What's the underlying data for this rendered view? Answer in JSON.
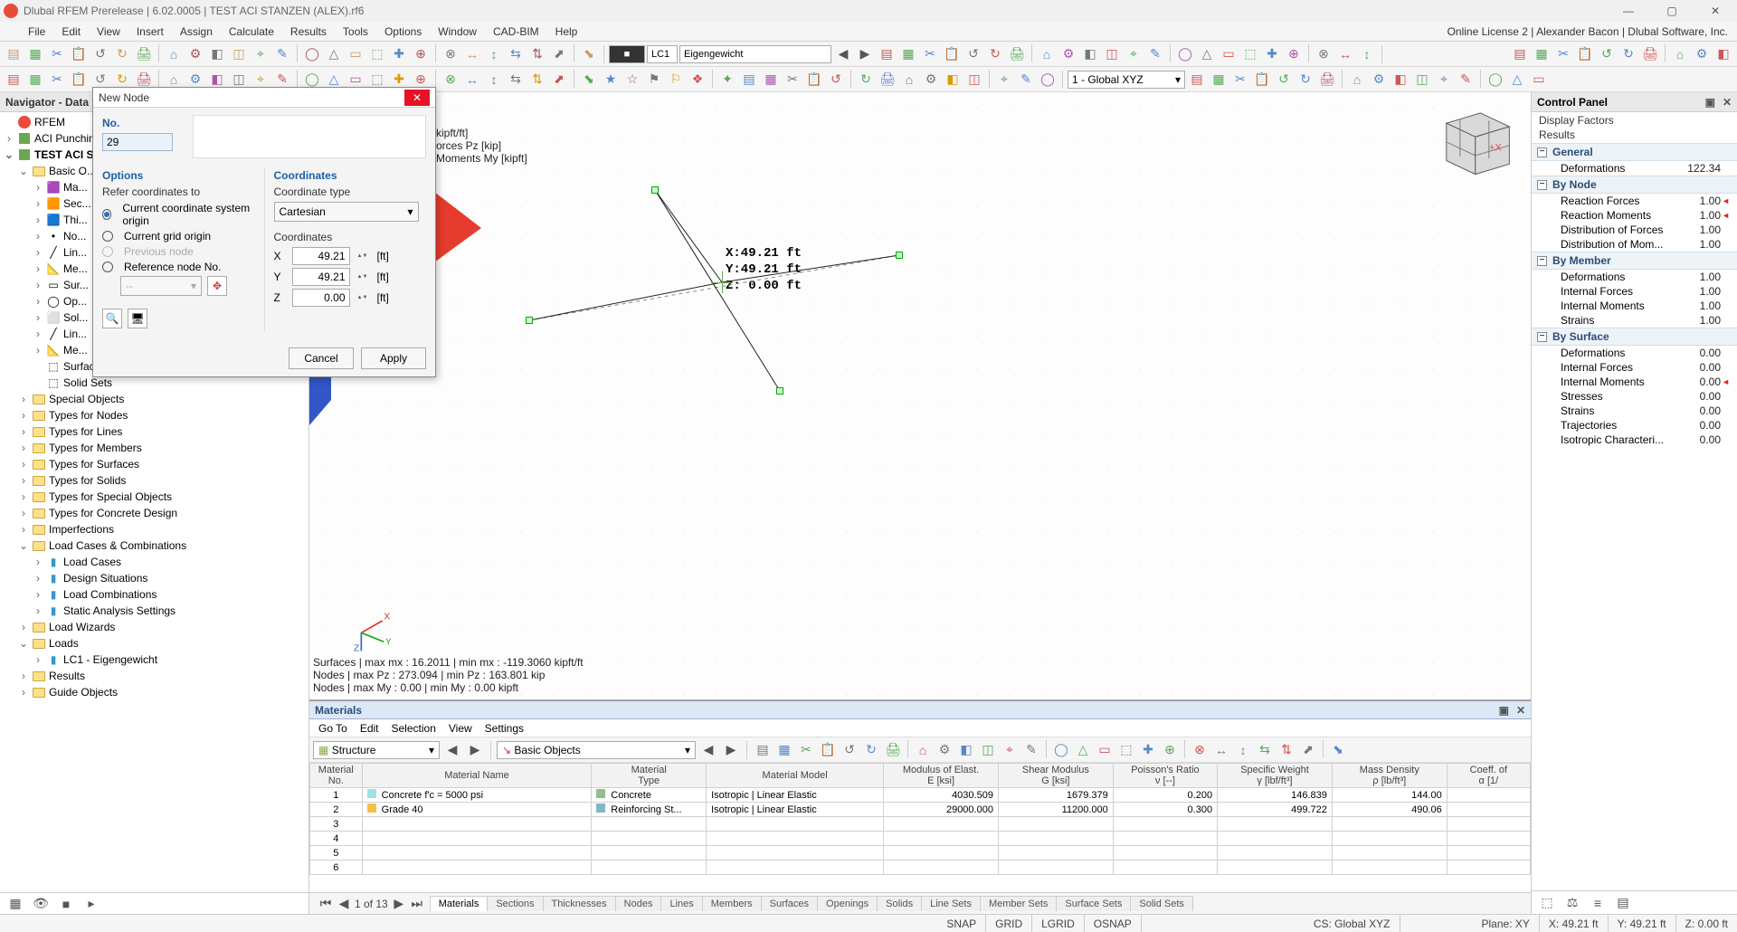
{
  "app_title": "Dlubal RFEM Prerelease | 6.02.0005 | TEST ACI STANZEN (ALEX).rf6",
  "license_text": "Online License 2 | Alexander Bacon | Dlubal Software, Inc.",
  "menus": [
    "File",
    "Edit",
    "View",
    "Insert",
    "Assign",
    "Calculate",
    "Results",
    "Tools",
    "Options",
    "Window",
    "CAD-BIM",
    "Help"
  ],
  "lc_name": "LC1",
  "lc_desc": "Eigengewicht",
  "coord_system": "1 - Global XYZ",
  "navigator": {
    "title": "Navigator - Data",
    "root": "RFEM",
    "top1": "ACI Punchin...",
    "top2": "TEST ACI S...",
    "basic": "Basic O...",
    "bo_items": [
      "Ma...",
      "Sec...",
      "Thi...",
      "No...",
      "Lin...",
      "Me...",
      "Sur...",
      "Op...",
      "Sol...",
      "Lin...",
      "Me..."
    ],
    "bo_tail": [
      "Surface Sets",
      "Solid Sets"
    ],
    "sections": [
      "Special Objects",
      "Types for Nodes",
      "Types for Lines",
      "Types for Members",
      "Types for Surfaces",
      "Types for Solids",
      "Types for Special Objects",
      "Types for Concrete Design",
      "Imperfections"
    ],
    "lcc": "Load Cases & Combinations",
    "lcc_items": [
      "Load Cases",
      "Design Situations",
      "Load Combinations",
      "Static Analysis Settings"
    ],
    "bottom": [
      "Load Wizards",
      "Loads"
    ],
    "lc_child": "LC1 - Eigengewicht",
    "tail": [
      "Results",
      "Guide Objects"
    ]
  },
  "viewport": {
    "labels_top": [
      "kipft/ft]",
      "orces Pz [kip]",
      "Moments My [kipft]"
    ],
    "pos_x": "X:49.21 ft",
    "pos_y": "Y:49.21 ft",
    "pos_z": "Z: 0.00 ft",
    "info1": "Surfaces | max mx : 16.2011 | min mx : -119.3060 kipft/ft",
    "info2": "Nodes | max Pz : 273.094 | min Pz : 163.801 kip",
    "info3": "Nodes | max My : 0.00 | min My : 0.00 kipft"
  },
  "materials": {
    "title": "Materials",
    "menus": [
      "Go To",
      "Edit",
      "Selection",
      "View",
      "Settings"
    ],
    "combo1": "Structure",
    "combo2": "Basic Objects",
    "cols": [
      "Material\nNo.",
      "Material Name",
      "Material\nType",
      "Material Model",
      "Modulus of Elast.\nE [ksi]",
      "Shear Modulus\nG [ksi]",
      "Poisson's Ratio\nν [--]",
      "Specific Weight\nγ [lbf/ft³]",
      "Mass Density\nρ [lb/ft³]",
      "Coeff. of\nα [1/"
    ],
    "rows": [
      {
        "no": "1",
        "name": "Concrete f'c = 5000 psi",
        "type": "Concrete",
        "model": "Isotropic | Linear Elastic",
        "E": "4030.509",
        "G": "1679.379",
        "nu": "0.200",
        "gamma": "146.839",
        "rho": "144.00",
        "alpha": ""
      },
      {
        "no": "2",
        "name": "Grade 40",
        "type": "Reinforcing St...",
        "model": "Isotropic | Linear Elastic",
        "E": "29000.000",
        "G": "11200.000",
        "nu": "0.300",
        "gamma": "499.722",
        "rho": "490.06",
        "alpha": ""
      },
      {
        "no": "3"
      },
      {
        "no": "4"
      },
      {
        "no": "5"
      },
      {
        "no": "6"
      }
    ],
    "page": "1 of 13",
    "tabs": [
      "Materials",
      "Sections",
      "Thicknesses",
      "Nodes",
      "Lines",
      "Members",
      "Surfaces",
      "Openings",
      "Solids",
      "Line Sets",
      "Member Sets",
      "Surface Sets",
      "Solid Sets"
    ]
  },
  "ctrl": {
    "title": "Control Panel",
    "sub1": "Display Factors",
    "sub2": "Results",
    "groups": [
      {
        "name": "General",
        "items": [
          [
            "Deformations",
            "122.34",
            ""
          ]
        ]
      },
      {
        "name": "By Node",
        "items": [
          [
            "Reaction Forces",
            "1.00",
            "◄"
          ],
          [
            "Reaction Moments",
            "1.00",
            "◄"
          ],
          [
            "Distribution of Forces",
            "1.00",
            ""
          ],
          [
            "Distribution of Mom...",
            "1.00",
            ""
          ]
        ]
      },
      {
        "name": "By Member",
        "items": [
          [
            "Deformations",
            "1.00",
            ""
          ],
          [
            "Internal Forces",
            "1.00",
            ""
          ],
          [
            "Internal Moments",
            "1.00",
            ""
          ],
          [
            "Strains",
            "1.00",
            ""
          ]
        ]
      },
      {
        "name": "By Surface",
        "items": [
          [
            "Deformations",
            "0.00",
            ""
          ],
          [
            "Internal Forces",
            "0.00",
            ""
          ],
          [
            "Internal Moments",
            "0.00",
            "◄"
          ],
          [
            "Stresses",
            "0.00",
            ""
          ],
          [
            "Strains",
            "0.00",
            ""
          ],
          [
            "Trajectories",
            "0.00",
            ""
          ],
          [
            "Isotropic Characteri...",
            "0.00",
            ""
          ]
        ]
      }
    ]
  },
  "status": {
    "snap": "SNAP",
    "grid": "GRID",
    "lgrid": "LGRID",
    "osnap": "OSNAP",
    "cs": "CS: Global XYZ",
    "plane": "Plane: XY",
    "x": "X: 49.21 ft",
    "y": "Y: 49.21 ft",
    "z": "Z: 0.00 ft"
  },
  "dialog": {
    "title": "New Node",
    "no_lbl": "No.",
    "no_val": "29",
    "options": "Options",
    "refer": "Refer coordinates to",
    "r1": "Current coordinate system origin",
    "r2": "Current grid origin",
    "r3": "Previous node",
    "r4": "Reference node No.",
    "coords": "Coordinates",
    "ctype_lbl": "Coordinate type",
    "ctype_val": "Cartesian",
    "coord_lbl": "Coordinates",
    "x": "X",
    "y": "Y",
    "z": "Z",
    "xv": "49.21",
    "yv": "49.21",
    "zv": "0.00",
    "unit": "[ft]",
    "cancel": "Cancel",
    "apply": "Apply"
  }
}
